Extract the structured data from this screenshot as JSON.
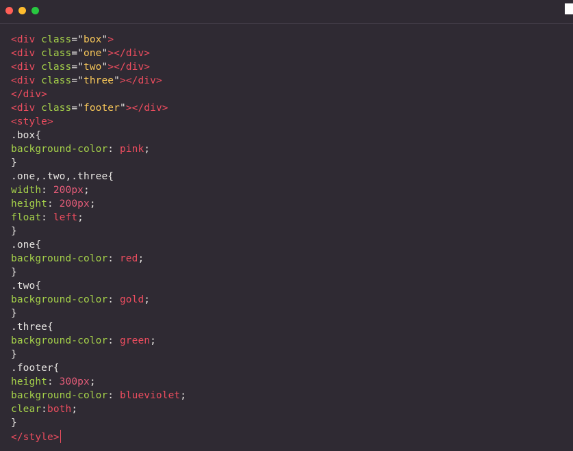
{
  "window": {
    "controls": [
      {
        "name": "close",
        "color": "#ff5f57"
      },
      {
        "name": "minimize",
        "color": "#febc2e"
      },
      {
        "name": "zoom",
        "color": "#28c840"
      }
    ]
  },
  "colors": {
    "tag": "#ee4d5f",
    "attr": "#a5d14a",
    "string": "#f9c859",
    "plain": "#e8e6e3",
    "value": "#ee4d5f",
    "number": "#e95d7a",
    "caret": "#ee4d5f"
  },
  "code": {
    "lines": [
      [
        {
          "t": "<div ",
          "c": "tag"
        },
        {
          "t": "class",
          "c": "attr"
        },
        {
          "t": "=\"",
          "c": "plain"
        },
        {
          "t": "box",
          "c": "string"
        },
        {
          "t": "\"",
          "c": "plain"
        },
        {
          "t": ">",
          "c": "tag"
        }
      ],
      [
        {
          "t": "<div ",
          "c": "tag"
        },
        {
          "t": "class",
          "c": "attr"
        },
        {
          "t": "=\"",
          "c": "plain"
        },
        {
          "t": "one",
          "c": "string"
        },
        {
          "t": "\"",
          "c": "plain"
        },
        {
          "t": "></div>",
          "c": "tag"
        }
      ],
      [
        {
          "t": "<div ",
          "c": "tag"
        },
        {
          "t": "class",
          "c": "attr"
        },
        {
          "t": "=\"",
          "c": "plain"
        },
        {
          "t": "two",
          "c": "string"
        },
        {
          "t": "\"",
          "c": "plain"
        },
        {
          "t": "></div>",
          "c": "tag"
        }
      ],
      [
        {
          "t": "<div ",
          "c": "tag"
        },
        {
          "t": "class",
          "c": "attr"
        },
        {
          "t": "=\"",
          "c": "plain"
        },
        {
          "t": "three",
          "c": "string"
        },
        {
          "t": "\"",
          "c": "plain"
        },
        {
          "t": "></div>",
          "c": "tag"
        }
      ],
      [
        {
          "t": "</div>",
          "c": "tag"
        }
      ],
      [
        {
          "t": "<div ",
          "c": "tag"
        },
        {
          "t": "class",
          "c": "attr"
        },
        {
          "t": "=\"",
          "c": "plain"
        },
        {
          "t": "footer",
          "c": "string"
        },
        {
          "t": "\"",
          "c": "plain"
        },
        {
          "t": "></div>",
          "c": "tag"
        }
      ],
      [
        {
          "t": "<style>",
          "c": "tag"
        }
      ],
      [
        {
          "t": ".box{",
          "c": "plain"
        }
      ],
      [
        {
          "t": "background-color",
          "c": "attr"
        },
        {
          "t": ": ",
          "c": "plain"
        },
        {
          "t": "pink",
          "c": "value"
        },
        {
          "t": ";",
          "c": "plain"
        }
      ],
      [
        {
          "t": "}",
          "c": "plain"
        }
      ],
      [
        {
          "t": ".one,.two,.three{",
          "c": "plain"
        }
      ],
      [
        {
          "t": "width",
          "c": "attr"
        },
        {
          "t": ": ",
          "c": "plain"
        },
        {
          "t": "200px",
          "c": "number"
        },
        {
          "t": ";",
          "c": "plain"
        }
      ],
      [
        {
          "t": "height",
          "c": "attr"
        },
        {
          "t": ": ",
          "c": "plain"
        },
        {
          "t": "200px",
          "c": "number"
        },
        {
          "t": ";",
          "c": "plain"
        }
      ],
      [
        {
          "t": "float",
          "c": "attr"
        },
        {
          "t": ": ",
          "c": "plain"
        },
        {
          "t": "left",
          "c": "value"
        },
        {
          "t": ";",
          "c": "plain"
        }
      ],
      [
        {
          "t": "}",
          "c": "plain"
        }
      ],
      [
        {
          "t": ".one{",
          "c": "plain"
        }
      ],
      [
        {
          "t": "background-color",
          "c": "attr"
        },
        {
          "t": ": ",
          "c": "plain"
        },
        {
          "t": "red",
          "c": "value"
        },
        {
          "t": ";",
          "c": "plain"
        }
      ],
      [
        {
          "t": "}",
          "c": "plain"
        }
      ],
      [
        {
          "t": ".two{",
          "c": "plain"
        }
      ],
      [
        {
          "t": "background-color",
          "c": "attr"
        },
        {
          "t": ": ",
          "c": "plain"
        },
        {
          "t": "gold",
          "c": "value"
        },
        {
          "t": ";",
          "c": "plain"
        }
      ],
      [
        {
          "t": "}",
          "c": "plain"
        }
      ],
      [
        {
          "t": ".three{",
          "c": "plain"
        }
      ],
      [
        {
          "t": "background-color",
          "c": "attr"
        },
        {
          "t": ": ",
          "c": "plain"
        },
        {
          "t": "green",
          "c": "value"
        },
        {
          "t": ";",
          "c": "plain"
        }
      ],
      [
        {
          "t": "}",
          "c": "plain"
        }
      ],
      [
        {
          "t": ".footer{",
          "c": "plain"
        }
      ],
      [
        {
          "t": "height",
          "c": "attr"
        },
        {
          "t": ": ",
          "c": "plain"
        },
        {
          "t": "300px",
          "c": "number"
        },
        {
          "t": ";",
          "c": "plain"
        }
      ],
      [
        {
          "t": "background-color",
          "c": "attr"
        },
        {
          "t": ": ",
          "c": "plain"
        },
        {
          "t": "blueviolet",
          "c": "value"
        },
        {
          "t": ";",
          "c": "plain"
        }
      ],
      [
        {
          "t": "clear",
          "c": "attr"
        },
        {
          "t": ":",
          "c": "plain"
        },
        {
          "t": "both",
          "c": "value"
        },
        {
          "t": ";",
          "c": "plain"
        }
      ],
      [
        {
          "t": "}",
          "c": "plain"
        }
      ],
      [
        {
          "t": "</style>",
          "c": "tag"
        }
      ]
    ]
  }
}
